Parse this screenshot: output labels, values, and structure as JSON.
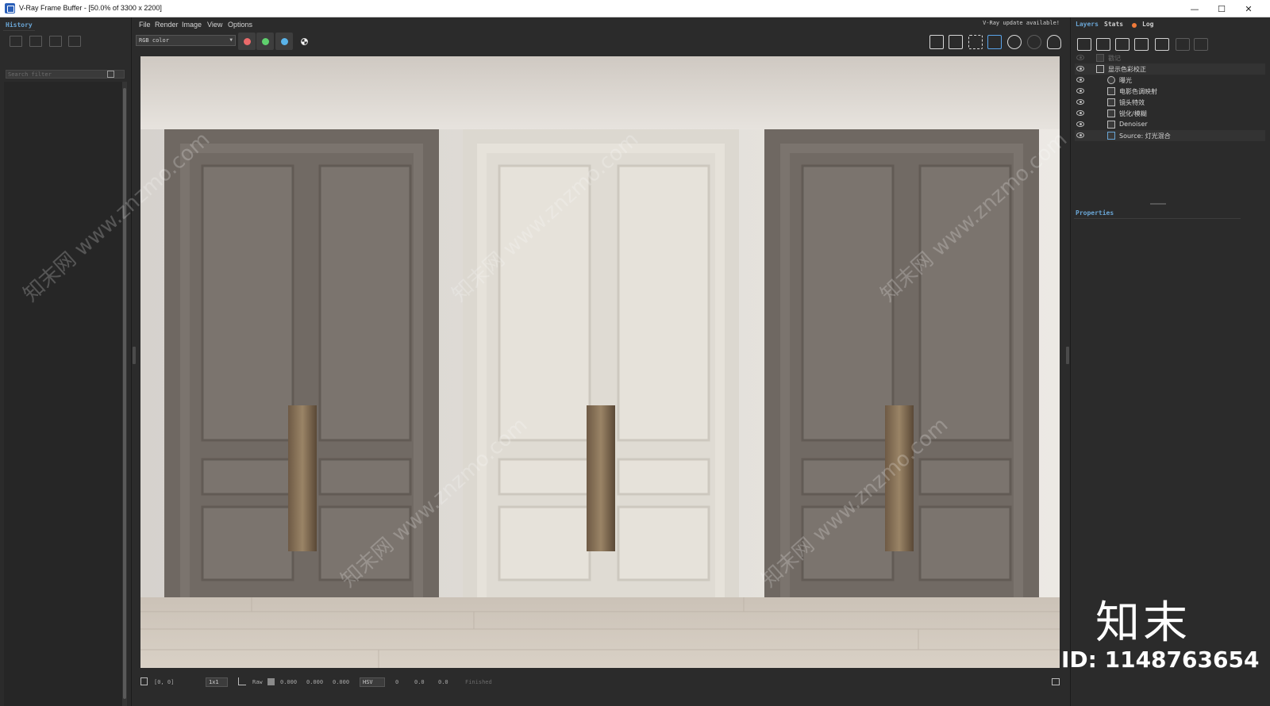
{
  "window": {
    "title": "V-Ray Frame Buffer - [50.0% of 3300 x 2200]",
    "minimize": "—",
    "maximize": "☐",
    "close": "✕"
  },
  "history": {
    "tab": "History",
    "search_placeholder": "Search filter"
  },
  "menu": {
    "items": [
      "File",
      "Render",
      "Image",
      "View",
      "Options"
    ],
    "update_notice": "V-Ray update available!"
  },
  "toolbar": {
    "channel_select": "RGB color",
    "channels": [
      {
        "name": "red",
        "color": "#ea6a6a"
      },
      {
        "name": "green",
        "color": "#5fd06d"
      },
      {
        "name": "blue",
        "color": "#5ab4ea"
      }
    ]
  },
  "status": {
    "coords": "[0, 0]",
    "zoom": "1x1",
    "raw_label": "Raw",
    "r": "0.000",
    "g": "0.000",
    "b": "0.000",
    "mode": "HSV",
    "h": "0",
    "s": "0.0",
    "v": "0.0",
    "state": "Finished"
  },
  "right_panel": {
    "tabs": [
      "Layers",
      "Stats",
      "Log"
    ],
    "layers": [
      {
        "label": "戳记",
        "visible": false,
        "indent": 0,
        "icon": "stamp-icon"
      },
      {
        "label": "显示色彩校正",
        "visible": true,
        "indent": 0,
        "icon": "color-correction-icon"
      },
      {
        "label": "曝光",
        "visible": true,
        "indent": 1,
        "icon": "exposure-icon"
      },
      {
        "label": "电影色调映射",
        "visible": true,
        "indent": 1,
        "icon": "tone-mapping-icon"
      },
      {
        "label": "镜头特效",
        "visible": true,
        "indent": 1,
        "icon": "lens-effects-icon"
      },
      {
        "label": "锐化/模糊",
        "visible": true,
        "indent": 1,
        "icon": "sharpen-blur-icon"
      },
      {
        "label": "Denoiser",
        "visible": true,
        "indent": 1,
        "icon": "denoiser-icon"
      },
      {
        "label": "Source: 灯光混合",
        "visible": true,
        "indent": 1,
        "icon": "source-lightmix-icon"
      }
    ],
    "properties_label": "Properties"
  },
  "watermark": {
    "site": "知末网 www.znzmo.com",
    "logo": "知末",
    "id": "ID: 1148763654"
  },
  "colors": {
    "accent": "#6aa6d6",
    "panel_bg": "#2b2b2b",
    "door_dark": "#77706a",
    "door_light": "#e2ded6"
  }
}
